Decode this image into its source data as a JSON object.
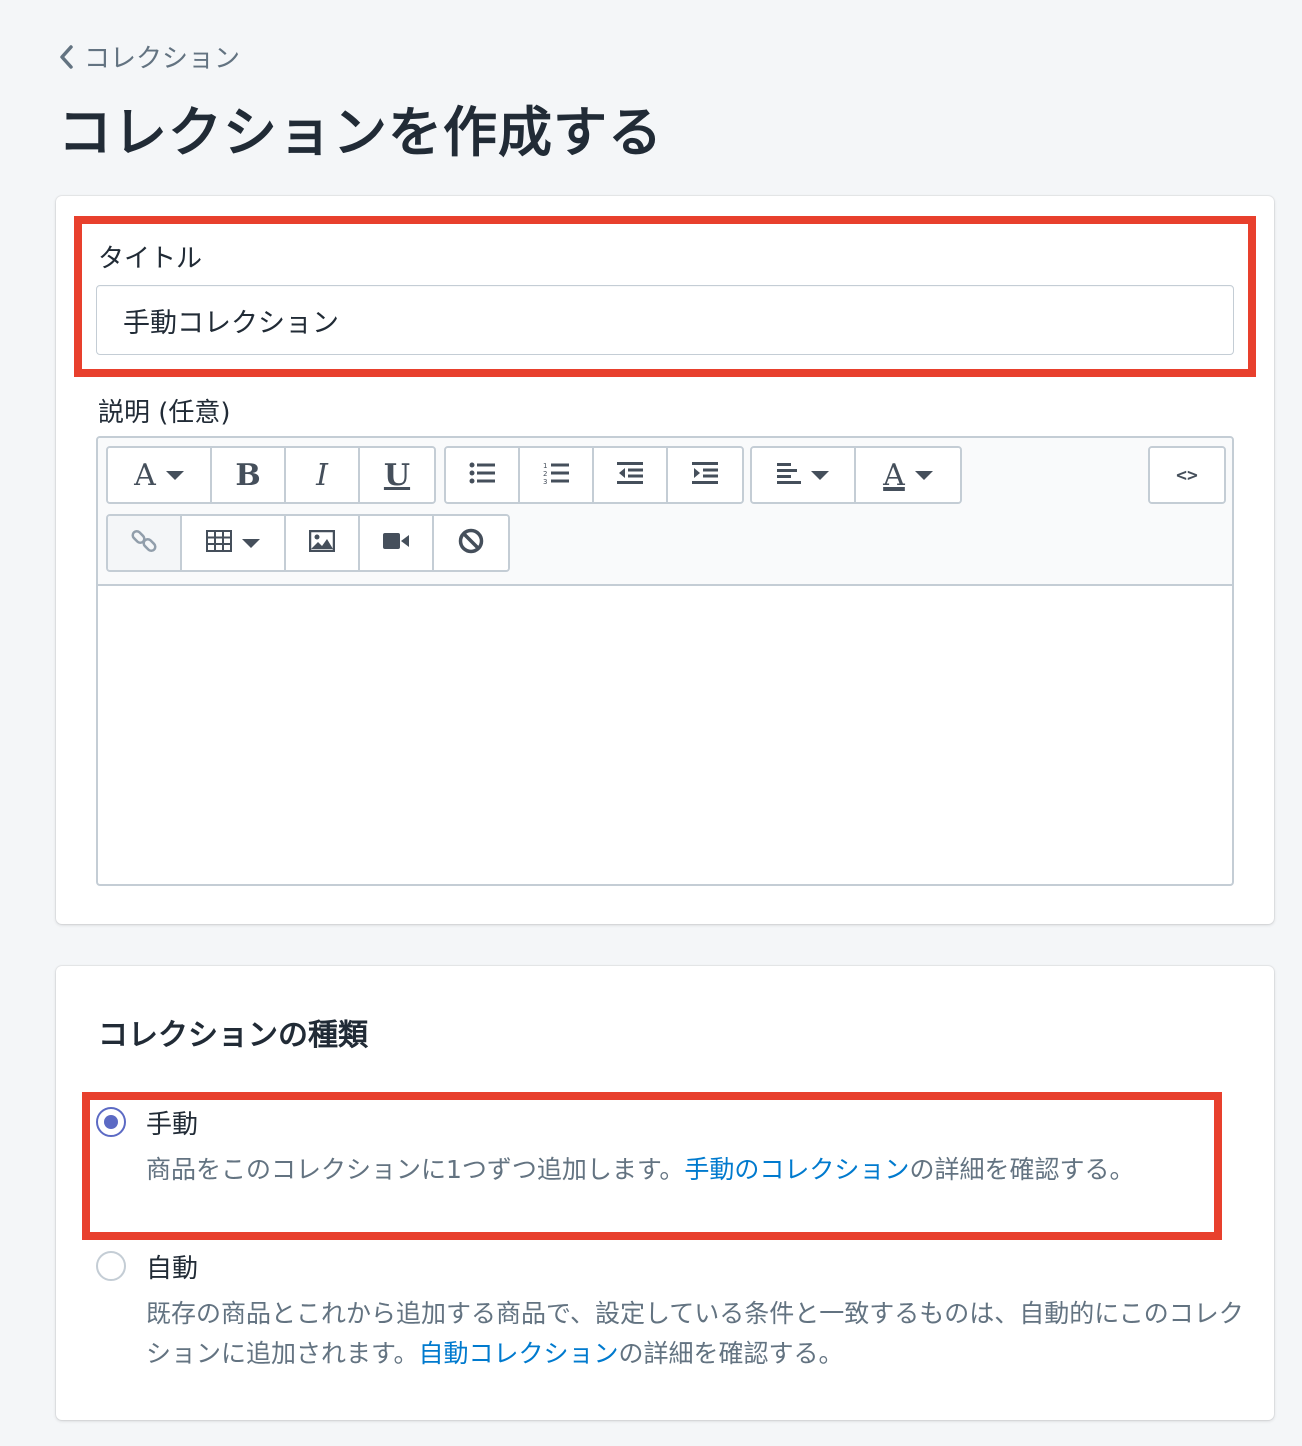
{
  "breadcrumb": {
    "label": "コレクション"
  },
  "page": {
    "title": "コレクションを作成する"
  },
  "form": {
    "title_label": "タイトル",
    "title_value": "手動コレクション",
    "description_label": "説明 (任意)",
    "html_button_label": "<>",
    "editor_toolbar": {
      "row1": [
        "font-style",
        "bold",
        "italic",
        "underline",
        "bulleted-list",
        "numbered-list",
        "outdent",
        "indent",
        "align",
        "text-color",
        "html"
      ],
      "row2": [
        "link",
        "table",
        "image",
        "video",
        "clear-formatting"
      ],
      "letters": {
        "font": "A",
        "bold": "B",
        "italic": "I",
        "underline": "U",
        "color": "A"
      }
    }
  },
  "collection_type": {
    "heading": "コレクションの種類",
    "manual": {
      "label": "手動",
      "checked": true,
      "help_before": "商品をこのコレクションに1つずつ追加します。",
      "help_link": "手動のコレクション",
      "help_after": "の詳細を確認する。"
    },
    "automatic": {
      "label": "自動",
      "checked": false,
      "help_before": "既存の商品とこれから追加する商品で、設定している条件と一致するものは、自動的にこのコレクションに追加されます。",
      "help_link": "自動コレクション",
      "help_after": "の詳細を確認する。"
    }
  },
  "colors": {
    "highlight": "#e8402d",
    "link": "#007ace",
    "radio": "#5c6ac4"
  }
}
